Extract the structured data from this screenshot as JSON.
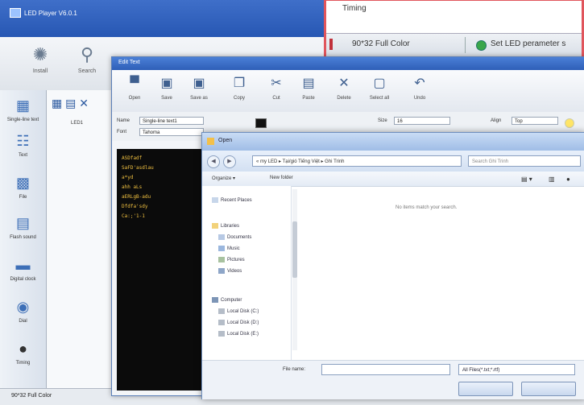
{
  "app": {
    "title": "LED Player V6.0.1"
  },
  "main_toolbar": [
    {
      "id": "settings",
      "label": "Install",
      "icon": "gear-icon"
    },
    {
      "id": "search",
      "label": "Search",
      "icon": "search-icon"
    }
  ],
  "sidebar": [
    {
      "label": "Single-line text",
      "icon": "text-icon"
    },
    {
      "label": "Text",
      "icon": "text-file-icon"
    },
    {
      "label": "File",
      "icon": "picture-icon"
    },
    {
      "label": "Flash sound",
      "icon": "sound-icon"
    },
    {
      "label": "Digital clock",
      "icon": "clock-icon"
    },
    {
      "label": "Dial",
      "icon": "dial-icon"
    },
    {
      "label": "Timing",
      "icon": "timer-icon"
    }
  ],
  "tree": {
    "root": "LED1"
  },
  "status": {
    "panel": "90*32 Full Color"
  },
  "inset": {
    "timing_label": "Timing",
    "panel_label": "90*32 Full Color",
    "setled_label": "Set LED perameter s"
  },
  "edit_window": {
    "title": "Edit Text",
    "toolbar": [
      {
        "label": "Open",
        "icon": "folder-open-icon"
      },
      {
        "label": "Save",
        "icon": "save-icon"
      },
      {
        "label": "Save as",
        "icon": "save-as-icon"
      },
      {
        "label": "Copy",
        "icon": "copy-icon"
      },
      {
        "label": "Cut",
        "icon": "cut-icon"
      },
      {
        "label": "Paste",
        "icon": "paste-icon"
      },
      {
        "label": "Delete",
        "icon": "delete-icon"
      },
      {
        "label": "Select all",
        "icon": "select-all-icon"
      },
      {
        "label": "Undo",
        "icon": "undo-icon"
      }
    ],
    "font_row": {
      "name_label": "Name",
      "name_value": "Single-line text1",
      "font_label": "Font",
      "font_value": "Tahoma",
      "size_label": "Size",
      "size_value": "16",
      "align_label": "Align",
      "align_value": "Top"
    },
    "editor_lines": [
      "ASDfadf",
      "SaFD'asdlau",
      "a*yd",
      "ahh aLs",
      "aERLgB-adu",
      "Dfdfa'sdy",
      "Ca:;'1-1"
    ]
  },
  "open_dialog": {
    "title": "Open",
    "address": "« my LED ▸ Tại/gió Tiếng Việt ▸ Ghi Trinh",
    "search_placeholder": "Search Ghi Trinh",
    "organize": "Organize ▾",
    "new_folder": "New folder",
    "nav": {
      "recent": "Recent Places",
      "libraries": "Libraries",
      "documents": "Documents",
      "music": "Music",
      "pictures": "Pictures",
      "videos": "Videos",
      "computer": "Computer",
      "disk_c": "Local Disk (C:)",
      "disk_d": "Local Disk (D:)",
      "disk_e": "Local Disk (E:)"
    },
    "empty_message": "No items match your search.",
    "filename_label": "File name:",
    "filetype_value": "All Files(*.txt;*.rtf)"
  }
}
